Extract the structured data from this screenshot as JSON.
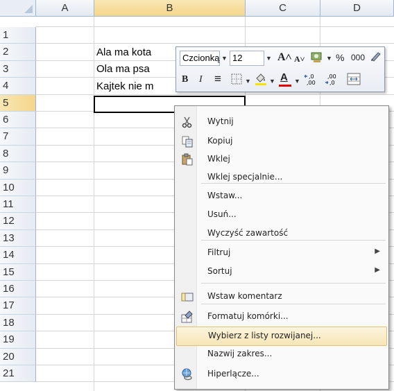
{
  "sheet": {
    "columns": [
      "A",
      "B",
      "C",
      "D"
    ],
    "rows": [
      "1",
      "2",
      "3",
      "4",
      "5",
      "6",
      "7",
      "8",
      "9",
      "10",
      "11",
      "12",
      "13",
      "14",
      "15",
      "16",
      "17",
      "18",
      "19",
      "20",
      "21"
    ],
    "cells": {
      "B2": "Ala ma kota",
      "B3": "Ola ma psa",
      "B4": "Kajtek nie m"
    },
    "active_cell": "B5"
  },
  "minibar": {
    "font_name": "Czcionką",
    "font_size": "12",
    "grow_font": "A˄",
    "shrink_font": "A˅",
    "percent": "%",
    "thousands": "000",
    "bold": "B",
    "italic": "I",
    "align_center": "≡",
    "font_color": "A",
    "increase_decimal": "←,0 ,00",
    "decrease_decimal": ",00 →,0"
  },
  "context_menu": {
    "items": [
      {
        "label": "Wytnij",
        "icon": "scissors-icon"
      },
      {
        "label": "Kopiuj",
        "icon": "copy-icon"
      },
      {
        "label": "Wklej",
        "icon": "paste-icon"
      },
      {
        "label": "Wklej specjalnie...",
        "icon": ""
      },
      {
        "label": "Wstaw...",
        "icon": ""
      },
      {
        "label": "Usuń...",
        "icon": ""
      },
      {
        "label": "Wyczyść zawartość",
        "icon": ""
      },
      {
        "label": "Filtruj",
        "icon": "",
        "submenu": true
      },
      {
        "label": "Sortuj",
        "icon": "",
        "submenu": true
      },
      {
        "label": "Wstaw komentarz",
        "icon": "comment-icon"
      },
      {
        "label": "Formatuj komórki...",
        "icon": "format-cells-icon"
      },
      {
        "label": "Wybierz z listy rozwijanej...",
        "icon": "",
        "highlighted": true
      },
      {
        "label": "Nazwij zakres...",
        "icon": ""
      },
      {
        "label": "Hiperlącze...",
        "icon": "hyperlink-icon"
      }
    ],
    "submenu_arrow": "▶"
  }
}
